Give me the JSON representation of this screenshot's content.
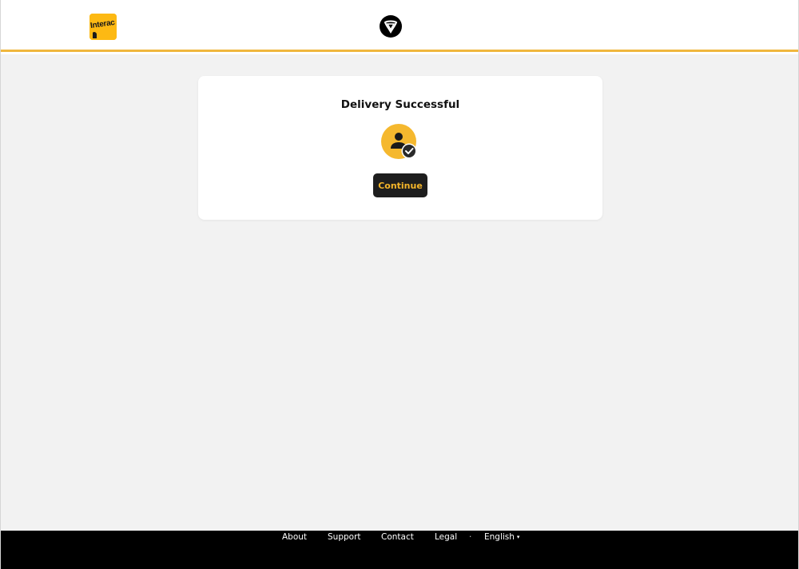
{
  "header": {
    "interac_logo_text": "Interac",
    "brand_color": "#fdb913",
    "accent_line_color": "#f0b73e",
    "ontario_logo": "ontario-trillium-icon"
  },
  "card": {
    "title": "Delivery Successful",
    "status_icon": "user-check-icon",
    "continue_label": "Continue"
  },
  "footer": {
    "links": [
      "About",
      "Support",
      "Contact",
      "Legal"
    ],
    "separator": "·",
    "language": "English",
    "language_caret": "▾"
  }
}
